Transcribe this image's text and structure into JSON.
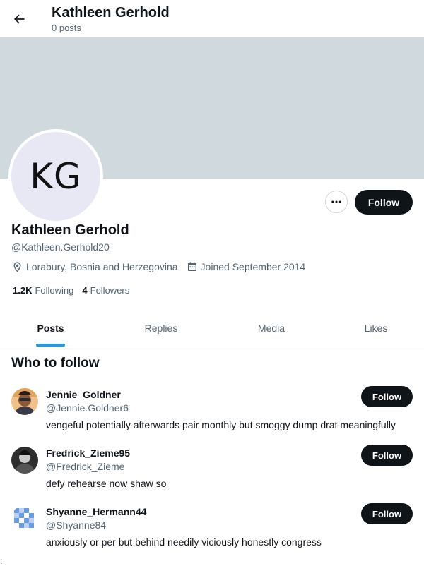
{
  "header": {
    "title": "Kathleen Gerhold",
    "post_count": "0 posts"
  },
  "colors": {
    "banner": "#cfd9de",
    "accent": "#1d9bf0",
    "button_dark": "#0f1419"
  },
  "profile": {
    "avatar_initials": "KG",
    "name": "Kathleen Gerhold",
    "handle": "@Kathleen.Gerhold20",
    "location": "Lorabury, Bosnia and Herzegovina",
    "joined": "Joined September 2014",
    "following_count": "1.2K",
    "following_label": "Following",
    "followers_count": "4",
    "followers_label": "Followers",
    "follow_label": "Follow"
  },
  "tabs": [
    {
      "label": "Posts",
      "active": true
    },
    {
      "label": "Replies",
      "active": false
    },
    {
      "label": "Media",
      "active": false
    },
    {
      "label": "Likes",
      "active": false
    }
  ],
  "who_to_follow": {
    "title": "Who to follow",
    "users": [
      {
        "name": "Jennie_Goldner",
        "handle": "@Jennie.Goldner6",
        "bio": "vengeful potentially afterwards pair monthly but smoggy dump drat meaningfully",
        "follow_label": "Follow"
      },
      {
        "name": "Fredrick_Zieme95",
        "handle": "@Fredrick_Zieme",
        "bio": "defy rehearse now shaw so",
        "follow_label": "Follow"
      },
      {
        "name": "Shyanne_Hermann44",
        "handle": "@Shyanne84",
        "bio": "anxiously or per but behind needily viciously honestly congress",
        "follow_label": "Follow"
      }
    ]
  },
  "edge_text": ":"
}
